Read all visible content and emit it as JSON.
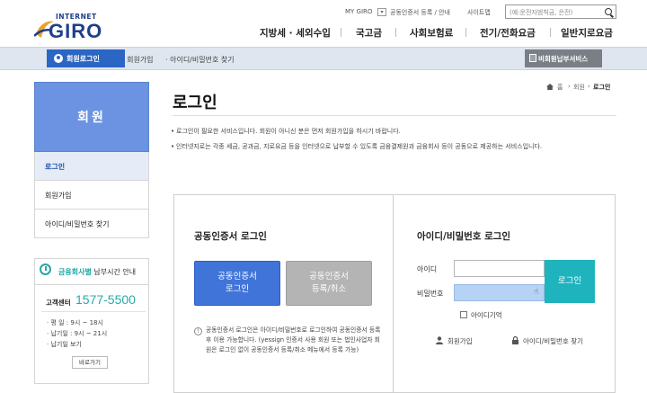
{
  "header": {
    "logo_small": "INTERNET",
    "logo_big": "GIRO",
    "util_links": [
      "MY GIRO",
      "공동인증서 등록 / 안내",
      "사이트맵"
    ],
    "search_placeholder": "(예:운전자범칙금, 은전)",
    "gnav": [
      "지방세 · 세외수입",
      "국고금",
      "사회보험료",
      "전기/전화요금",
      "일반지로요금"
    ]
  },
  "strip": {
    "login_tab": "회원로그인",
    "links": [
      "회원가입",
      "아이디/비밀번호 찾기"
    ],
    "nonmember": "비회원납부서비스"
  },
  "sidebar": {
    "title": "회원",
    "items": [
      {
        "label": "로그인",
        "active": true
      },
      {
        "label": "회원가입",
        "active": false
      },
      {
        "label": "아이디/비밀번호 찾기",
        "active": false
      }
    ],
    "hours_accent": "금융회사별",
    "hours_rest": "납부시간 안내",
    "cc_label": "고객센터",
    "cc_number": "1577-5500",
    "cc_rows": [
      "· 평   일 : 9시 ~ 18시",
      "· 납기일 : 9시 ~ 21시",
      "· 납기일 보기"
    ],
    "cc_btn": "바로가기"
  },
  "content": {
    "title": "로그인",
    "breadcrumb": [
      "홈",
      "회원",
      "로그인"
    ],
    "info": [
      "로그인이 필요한 서비스입니다. 회원이 아니신 분은 먼저 회원가입을 하시기 바랍니다.",
      "인터넷지로는 각종 세금, 공과금, 지로요금 등을 인터넷으로 납부할 수 있도록 금융결제원과 금융회사 등이 공동으로 제공하는 서비스입니다."
    ],
    "cert": {
      "heading": "공동인증서 로그인",
      "btn_login": "공동인증서\n로그인",
      "btn_register": "공동인증서\n등록/취소",
      "note": "공동인증서 로그인은 아이디/비밀번호로 로그인하여 공동인증서 등록 후 이용 가능합니다. (yessign 인증서 사용 회원 또는 법인사업자 회원은 로그인 없이 공동인증서 등록/취소 메뉴에서 등록 가능)"
    },
    "idpw": {
      "heading": "아이디/비밀번호 로그인",
      "id_label": "아이디",
      "pw_label": "비밀번호",
      "login_btn": "로그인",
      "remember": "아이디기억",
      "link_join": "회원가입",
      "link_find": "아이디/비밀번호 찾기"
    }
  }
}
